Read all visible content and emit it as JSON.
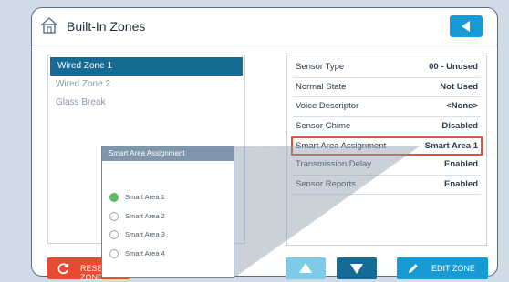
{
  "header": {
    "title": "Built-In Zones"
  },
  "zones": {
    "items": [
      {
        "label": "Wired Zone 1",
        "selected": true
      },
      {
        "label": "Wired Zone 2",
        "selected": false
      },
      {
        "label": "Glass Break",
        "selected": false
      }
    ]
  },
  "sensor": {
    "rows": [
      {
        "label": "Sensor Type",
        "value": "00 - Unused"
      },
      {
        "label": "Normal State",
        "value": "Not Used"
      },
      {
        "label": "Voice Descriptor",
        "value": "<None>"
      },
      {
        "label": "Sensor Chime",
        "value": "Disabled"
      },
      {
        "label": "Smart Area Assignment",
        "value": "Smart Area 1",
        "highlighted": true
      },
      {
        "label": "Transmission Delay",
        "value": "Enabled"
      },
      {
        "label": "Sensor Reports",
        "value": "Enabled"
      }
    ]
  },
  "popup": {
    "title": "Smart Area Assignment",
    "options": [
      {
        "label": "Smart Area 1",
        "selected": true
      },
      {
        "label": "Smart Area 2",
        "selected": false
      },
      {
        "label": "Smart Area 3",
        "selected": false
      },
      {
        "label": "Smart Area 4",
        "selected": false
      }
    ]
  },
  "buttons": {
    "reset_label": "RESET ZONE",
    "edit_label": "EDIT ZONE"
  },
  "icons": {
    "home": "home-icon",
    "back": "back-arrow-icon",
    "reset": "reset-icon",
    "up": "arrow-up-icon",
    "down": "arrow-down-icon",
    "edit": "pencil-icon"
  },
  "colors": {
    "accent": "#169bd5",
    "selected_row": "#156b94",
    "reset": "#e84a32",
    "highlight_border": "#e8503a",
    "radio_selected": "#5dbb63"
  }
}
